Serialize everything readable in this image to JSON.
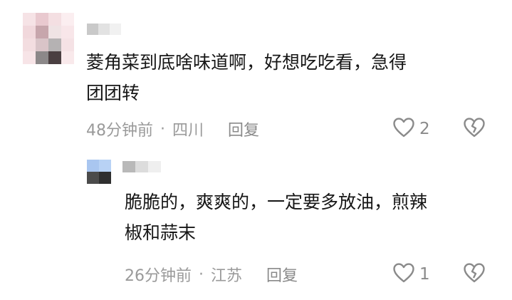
{
  "comment": {
    "text_lines": [
      "菱角菜到底啥味道啊，好想吃吃看，急得",
      "团团转"
    ],
    "time": "48分钟前",
    "separator": "·",
    "location": "四川",
    "reply_label": "回复",
    "like_count": "2",
    "icons": {
      "like": "heart-outline-icon",
      "dislike": "broken-heart-icon"
    }
  },
  "reply": {
    "text_lines": [
      "脆脆的，爽爽的，一定要多放油，煎辣",
      "椒和蒜末"
    ],
    "time": "26分钟前",
    "separator": "·",
    "location": "江苏",
    "reply_label": "回复",
    "like_count": "1",
    "icons": {
      "like": "heart-outline-icon",
      "dislike": "broken-heart-icon"
    }
  },
  "colors": {
    "text": "#161616",
    "meta": "#9a9a9a",
    "icon_stroke": "#8a8a8a",
    "background": "#ffffff"
  }
}
